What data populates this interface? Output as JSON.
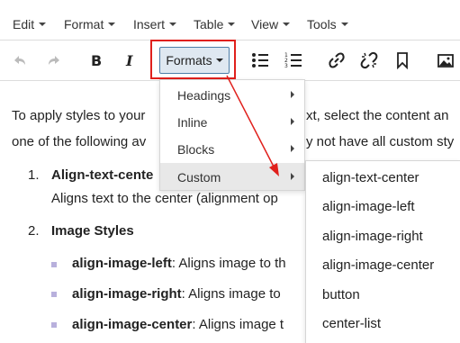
{
  "menubar": {
    "items": [
      "Edit",
      "Format",
      "Insert",
      "Table",
      "View",
      "Tools"
    ]
  },
  "toolbar": {
    "formats_label": "Formats",
    "icons": [
      "undo-icon",
      "redo-icon",
      "bold-icon",
      "italic-icon",
      "bullet-list-icon",
      "numbered-list-icon",
      "link-icon",
      "unlink-icon",
      "bookmark-icon",
      "image-icon"
    ]
  },
  "content": {
    "para_line1": "To apply styles to your",
    "para_line1_tail": "xt, select the content an",
    "para_line2": "one of the following av",
    "para_line2_tail": "y not have all custom sty",
    "list1_num": "1.",
    "list1_title": "Align-text-cente",
    "list1_desc": "Aligns text to the center (alignment op",
    "list2_num": "2.",
    "list2_title": "Image Styles",
    "bullet1_bold": "align-image-left",
    "bullet1_text": ": Aligns image to th",
    "bullet2_bold": "align-image-right",
    "bullet2_text": ": Aligns image to",
    "bullet3_bold": "align-image-center",
    "bullet3_text": ": Aligns image t"
  },
  "dropdown": {
    "items": [
      "Headings",
      "Inline",
      "Blocks",
      "Custom"
    ],
    "active": "Custom"
  },
  "submenu": {
    "items": [
      "align-text-center",
      "align-image-left",
      "align-image-right",
      "align-image-center",
      "button",
      "center-list"
    ]
  },
  "colors": {
    "highlight": "#e0201c",
    "bullet": "#b8b0dc",
    "formats_bg": "#dfe8f1"
  }
}
